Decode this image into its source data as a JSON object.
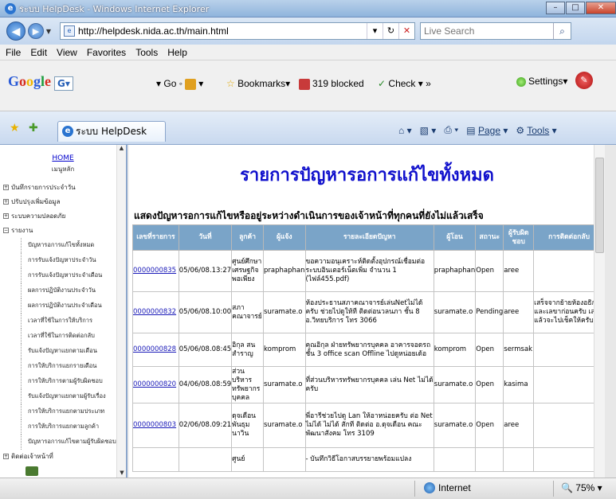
{
  "window": {
    "title": "ระบบ HelpDesk - Windows Internet Explorer",
    "minimize": "–",
    "maximize": "□",
    "close": "✕"
  },
  "address": {
    "url": "http://helpdesk.nida.ac.th/main.html",
    "search_placeholder": "Live Search"
  },
  "menu": [
    "File",
    "Edit",
    "View",
    "Favorites",
    "Tools",
    "Help"
  ],
  "google_toolbar": {
    "logo": "Google",
    "go": "Go",
    "bookmarks": "Bookmarks",
    "blocked": "319 blocked",
    "check": "Check",
    "more": "»",
    "settings": "Settings"
  },
  "tab": {
    "label": "ระบบ HelpDesk",
    "page": "Page",
    "tools": "Tools"
  },
  "sidebar": {
    "home": "HOME",
    "home_sub": "เมนูหลัก",
    "groups": [
      {
        "label": "บันทึกรายการประจำวัน",
        "box": "+"
      },
      {
        "label": "ปรับปรุงเพิ่มข้อมูล",
        "box": "+"
      },
      {
        "label": "ระบบความปลอดภัย",
        "box": "+"
      },
      {
        "label": "รายงาน",
        "box": "−"
      }
    ],
    "items": [
      "ปัญหารอการแก้ไขทั้งหมด",
      "การรับแจ้งปัญหาประจำวัน",
      "การรับแจ้งปัญหาประจำเดือน",
      "ผลการปฏิบัติงานประจำวัน",
      "ผลการปฏิบัติงานประจำเดือน",
      "เวลาที่ใช้ในการให้บริการ",
      "เวลาที่ใช้ในการติดต่อกลับ",
      "รับแจ้งปัญหาแยกตามเดือน",
      "การให้บริการแยกรายเดือน",
      "การให้บริการตามผู้รับผิดชอบ",
      "รับแจ้งปัญหาแยกตามผู้รับเรื่อง",
      "การให้บริการแยกตามประเภท",
      "การให้บริการแยกตามลูกค้า",
      "ปัญหารอการแก้ไขตามผู้รับผิดชอบ"
    ],
    "last_group": "ติดต่อเจ้าหน้าที่"
  },
  "main": {
    "title": "รายการปัญหารอการแก้ไขทั้งหมด",
    "subtitle": "แสดงปัญหารอการแก้ไขหรืออยู่ระหว่างดำเนินการของเจ้าหน้าที่ทุกคนที่ยังไม่แล้วเสร็จ",
    "columns": [
      "เลขที่รายการ",
      "วันที่",
      "ลูกค้า",
      "ผู้แจ้ง",
      "รายละเอียดปัญหา",
      "ผู้โอน",
      "สถานะ",
      "ผู้รับผิดชอบ",
      "การติดต่อกลับ"
    ],
    "rows": [
      {
        "id": "0000000835",
        "date": "05/06/08.13:27",
        "customer": "ศูนย์ศึกษาเศรษฐกิจพอเพียง",
        "reporter": "praphaphan",
        "detail": "ขอความอนุเคราะห์ติดตั้งอุปกรณ์เชื่อมต่อระบบอินเตอร์เน็ตเพิ่ม จำนวน 1 (ไฟล์455.pdf)",
        "transfer": "praphaphan",
        "status": "Open",
        "owner": "aree",
        "contact": ""
      },
      {
        "id": "0000000832",
        "date": "05/06/08.10:00",
        "customer": "สภาคณาจารย์",
        "reporter": "suramate.o",
        "detail": "ห้องประธานสภาคณาจารย์เล่นNetไม่ได้ครับ ช่วยไปดูให้ที ติดต่อนวลนภา ชั้น 8 อ.วิทยบริการ โทร 3066",
        "transfer": "suramate.o",
        "status": "Pending",
        "owner": "aree",
        "contact": "เสร็จจากย้ายห้องอธิการและเลขาก่อนครับ เสร็จแล้วจะไปเช็คให้ครับ"
      },
      {
        "id": "0000000828",
        "date": "05/06/08.08:45",
        "customer": "อิกุล สนสำราญ",
        "reporter": "komprom",
        "detail": "คุณอิกุล ฝ่ายทรัพยากรบุคคล อาคารจอดรถ ชั้น 3 office scan Offline ไปดูหน่อยเด้อ",
        "transfer": "komprom",
        "status": "Open",
        "owner": "sermsak",
        "contact": ""
      },
      {
        "id": "0000000820",
        "date": "04/06/08.08:59",
        "customer": "ส่วนบริหารทรัพยากรบุคคล",
        "reporter": "suramate.o",
        "detail": "ที่ส่วนบริหารทรัพยากรบุคคล เล่น Net ไม่ได้ครับ",
        "transfer": "suramate.o",
        "status": "Open",
        "owner": "kasima",
        "contact": ""
      },
      {
        "id": "0000000803",
        "date": "02/06/08.09:21",
        "customer": "ดุจเดือน พันธุมนาวิน",
        "reporter": "suramate.o",
        "detail": "พี่อารีช่วยไปดู Lan ให้อาหน่อยครับ ต่อ Net ไม่ได้ ไม่ได้ สักที ติดต่อ อ.ดุจเดือน คณะพัฒนาสังคม โทร 3109",
        "transfer": "suramate.o",
        "status": "Open",
        "owner": "aree",
        "contact": ""
      },
      {
        "id": "",
        "date": "",
        "customer": "ศูนย์",
        "reporter": "",
        "detail": "- บันทึกวิธีโอกาสบรรยายพร้อมแปลง",
        "transfer": "",
        "status": "",
        "owner": "",
        "contact": ""
      }
    ]
  },
  "status": {
    "zone": "Internet",
    "zoom": "75%"
  }
}
